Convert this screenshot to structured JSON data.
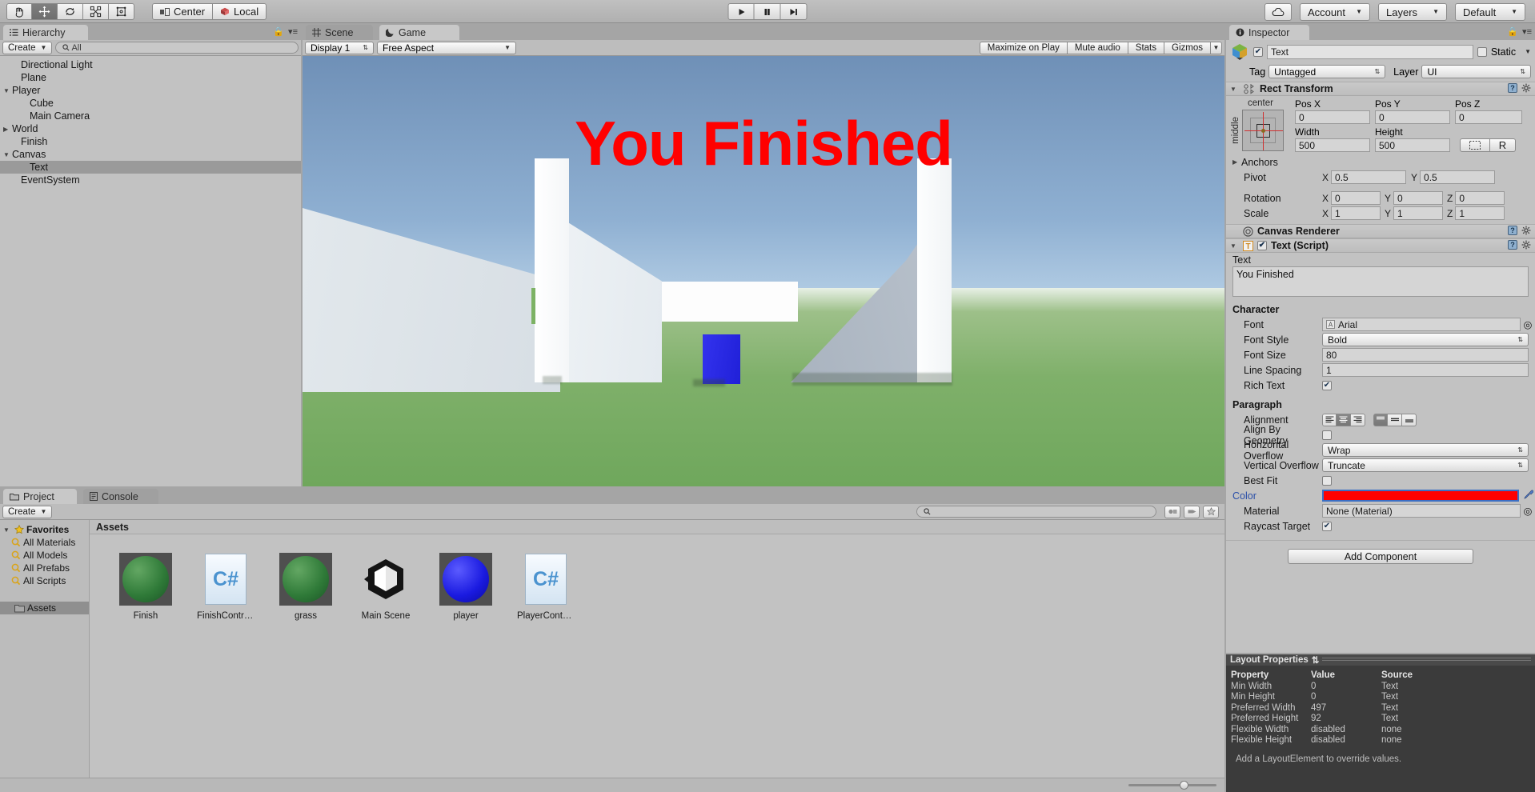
{
  "toolbar": {
    "tools": [
      {
        "name": "hand-tool",
        "selected": false
      },
      {
        "name": "move-tool",
        "selected": true
      },
      {
        "name": "rotate-tool",
        "selected": false
      },
      {
        "name": "scale-tool",
        "selected": false
      },
      {
        "name": "rect-tool",
        "selected": false
      }
    ],
    "pivot_mode": "Center",
    "pivot_rotation": "Local",
    "play": "play-icon",
    "pause": "pause-icon",
    "step": "step-icon",
    "cloud": "cloud-icon",
    "account": "Account",
    "layers": "Layers",
    "layout": "Default"
  },
  "hierarchy": {
    "tab": "Hierarchy",
    "create_label": "Create",
    "search_placeholder": "All",
    "items": [
      {
        "label": "Directional Light",
        "depth": 1,
        "arrow": "",
        "selected": false
      },
      {
        "label": "Plane",
        "depth": 1,
        "arrow": "",
        "selected": false
      },
      {
        "label": "Player",
        "depth": 0,
        "arrow": "▼",
        "selected": false
      },
      {
        "label": "Cube",
        "depth": 2,
        "arrow": "",
        "selected": false
      },
      {
        "label": "Main Camera",
        "depth": 2,
        "arrow": "",
        "selected": false
      },
      {
        "label": "World",
        "depth": 0,
        "arrow": "▶",
        "selected": false
      },
      {
        "label": "Finish",
        "depth": 1,
        "arrow": "",
        "selected": false
      },
      {
        "label": "Canvas",
        "depth": 0,
        "arrow": "▼",
        "selected": false
      },
      {
        "label": "Text",
        "depth": 2,
        "arrow": "",
        "selected": true
      },
      {
        "label": "EventSystem",
        "depth": 1,
        "arrow": "",
        "selected": false
      }
    ]
  },
  "gameview": {
    "tab_scene": "Scene",
    "tab_game": "Game",
    "display": "Display 1",
    "aspect": "Free Aspect",
    "maximize_on_play": "Maximize on Play",
    "mute_audio": "Mute audio",
    "stats": "Stats",
    "gizmos": "Gizmos",
    "overlay_text": "You Finished",
    "overlay_color": "#ff0000"
  },
  "project": {
    "tab_project": "Project",
    "tab_console": "Console",
    "create_label": "Create",
    "favorites_label": "Favorites",
    "favorites": [
      "All Materials",
      "All Models",
      "All Prefabs",
      "All Scripts"
    ],
    "root_folder": "Assets",
    "assets_header": "Assets",
    "assets": [
      {
        "name": "Finish",
        "icon": "green-sphere-icon"
      },
      {
        "name": "FinishContro...",
        "icon": "csharp-file-icon"
      },
      {
        "name": "grass",
        "icon": "green-sphere-icon"
      },
      {
        "name": "Main Scene",
        "icon": "unity-scene-icon"
      },
      {
        "name": "player",
        "icon": "blue-sphere-icon"
      },
      {
        "name": "PlayerControl...",
        "icon": "csharp-file-icon"
      }
    ]
  },
  "inspector": {
    "tab": "Inspector",
    "object_name": "Text",
    "enabled": true,
    "static_label": "Static",
    "tag_label": "Tag",
    "tag_value": "Untagged",
    "layer_label": "Layer",
    "layer_value": "UI",
    "rect_transform": {
      "title": "Rect Transform",
      "anchor_preset_top": "center",
      "anchor_preset_side": "middle",
      "pos_x_label": "Pos X",
      "pos_x": "0",
      "pos_y_label": "Pos Y",
      "pos_y": "0",
      "pos_z_label": "Pos Z",
      "pos_z": "0",
      "width_label": "Width",
      "width": "500",
      "height_label": "Height",
      "height": "500",
      "blueprint_label": "R",
      "anchors_label": "Anchors",
      "pivot_label": "Pivot",
      "pivot_x": "0.5",
      "pivot_y": "0.5",
      "rotation_label": "Rotation",
      "rot_x": "0",
      "rot_y": "0",
      "rot_z": "0",
      "scale_label": "Scale",
      "scale_x": "1",
      "scale_y": "1",
      "scale_z": "1"
    },
    "canvas_renderer": {
      "title": "Canvas Renderer"
    },
    "text_script": {
      "title": "Text (Script)",
      "enabled": true,
      "text_label": "Text",
      "text_value": "You Finished",
      "character_label": "Character",
      "font_label": "Font",
      "font_value": "Arial",
      "font_style_label": "Font Style",
      "font_style_value": "Bold",
      "font_size_label": "Font Size",
      "font_size_value": "80",
      "line_spacing_label": "Line Spacing",
      "line_spacing_value": "1",
      "rich_text_label": "Rich Text",
      "rich_text": true,
      "paragraph_label": "Paragraph",
      "alignment_label": "Alignment",
      "align_h_selected": 1,
      "align_v_selected": 0,
      "align_by_geometry_label": "Align By Geometry",
      "align_by_geometry": false,
      "horizontal_overflow_label": "Horizontal Overflow",
      "horizontal_overflow_value": "Wrap",
      "vertical_overflow_label": "Vertical Overflow",
      "vertical_overflow_value": "Truncate",
      "best_fit_label": "Best Fit",
      "best_fit": false,
      "color_label": "Color",
      "color_value": "#ff0000",
      "material_label": "Material",
      "material_value": "None (Material)",
      "raycast_target_label": "Raycast Target",
      "raycast_target": true
    },
    "add_component": "Add Component"
  },
  "layout_properties": {
    "title": "Layout Properties",
    "columns": [
      "Property",
      "Value",
      "Source"
    ],
    "rows": [
      [
        "Min Width",
        "0",
        "Text"
      ],
      [
        "Min Height",
        "0",
        "Text"
      ],
      [
        "Preferred Width",
        "497",
        "Text"
      ],
      [
        "Preferred Height",
        "92",
        "Text"
      ],
      [
        "Flexible Width",
        "disabled",
        "none"
      ],
      [
        "Flexible Height",
        "disabled",
        "none"
      ]
    ],
    "note": "Add a LayoutElement to override values."
  }
}
